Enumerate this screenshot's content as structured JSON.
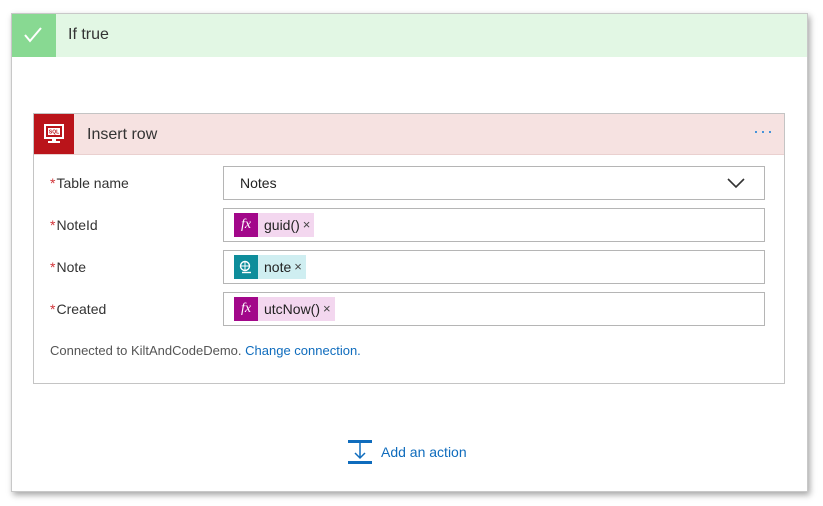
{
  "condition": {
    "title": "If true",
    "colors": {
      "header_bg": "#e2f7e4",
      "check_bg": "#88d992"
    },
    "icon": "checkmark-icon"
  },
  "action": {
    "title": "Insert row",
    "icon": "sql-icon",
    "more_label": "···",
    "colors": {
      "header_bg": "#f6e2e1",
      "icon_bg": "#ba141a"
    },
    "fields": {
      "table_name": {
        "required_mark": "*",
        "label": "Table name",
        "value": "Notes"
      },
      "note_id": {
        "required_mark": "*",
        "label": "NoteId",
        "token_text": "guid()",
        "token_type": "expression"
      },
      "note": {
        "required_mark": "*",
        "label": "Note",
        "token_text": "note",
        "token_type": "dynamic-content"
      },
      "created": {
        "required_mark": "*",
        "label": "Created",
        "token_text": "utcNow()",
        "token_type": "expression"
      }
    },
    "token_close": "×",
    "fx_glyph": "fx",
    "connection": {
      "text": "Connected to KiltAndCodeDemo.",
      "link": "Change connection."
    }
  },
  "add_action": {
    "label": "Add an action",
    "icon": "add-action-icon",
    "color": "#0f6cbd"
  }
}
